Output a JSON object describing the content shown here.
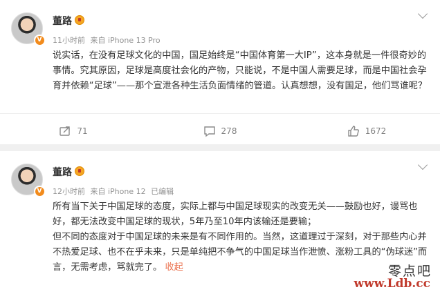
{
  "posts": [
    {
      "author": "董路",
      "time": "11小时前",
      "source": "来自 iPhone 13 Pro",
      "edited": "",
      "paragraphs": [
        "说实话，在没有足球文化的中国，国足始终是“中国体育第一大IP”，这本身就是一件很奇妙的事情。究其原因，足球是高度社会化的产物，只能说，不是中国人需要足球，而是中国社会孕育并依赖“足球”——那个宣泄各种生活负面情绪的管道。认真想想，没有国足，他们骂谁呢？"
      ],
      "actions": {
        "repost": "71",
        "comment": "278",
        "like": "1672"
      }
    },
    {
      "author": "董路",
      "time": "12小时前",
      "source": "来自 iPhone 12",
      "edited": "已编辑",
      "paragraphs": [
        "所有当下关于中国足球的态度，实际上都与中国足球现实的改变无关——鼓励也好，谩骂也好，都无法改变中国足球的现状，5年乃至10年内该输还是要输；",
        "但不同的态度对于中国足球的未来是有不同作用的。当然，这道理过于深刻，对于那些内心并不热爱足球、也不在乎未来，只是单纯把不争气的中国足球当作泄愤、涨粉工具的“伪球迷”而言，无需考虑，骂就完了。"
      ],
      "collapse_label": "收起"
    }
  ],
  "watermark": {
    "cn": "零点吧",
    "url": "www.Ldb.cc"
  },
  "icons": {
    "repost": "repost-icon",
    "comment": "comment-icon",
    "like": "thumbs-up-icon",
    "more": "chevron-down-icon",
    "verified": "verified-v-icon",
    "badge": "member-badge-icon"
  },
  "colors": {
    "accent_link": "#eb7350",
    "meta_gray": "#939393",
    "verified_orange": "#f28b1c",
    "watermark_red": "#c0392b"
  }
}
